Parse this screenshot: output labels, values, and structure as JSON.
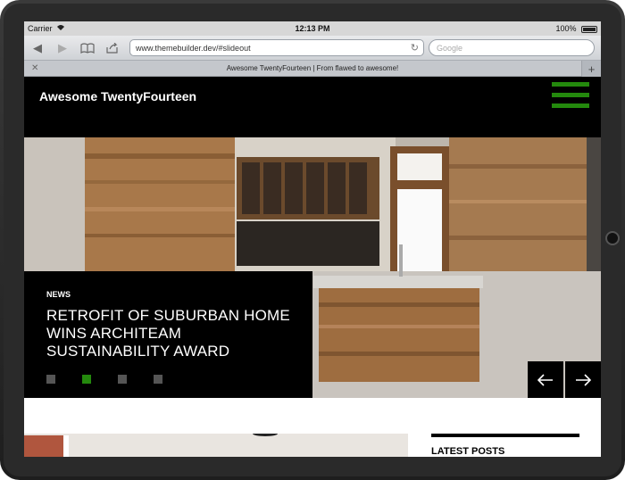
{
  "status_bar": {
    "carrier": "Carrier",
    "time": "12:13 PM",
    "battery": "100%"
  },
  "browser": {
    "url": "www.themebuilder.dev/#slideout",
    "search_placeholder": "Google",
    "tab_title": "Awesome TwentyFourteen | From flawed to awesome!"
  },
  "site": {
    "title": "Awesome TwentyFourteen"
  },
  "slider": {
    "category": "NEWS",
    "title": "RETROFIT OF SUBURBAN HOME WINS ARCHITEAM SUSTAINABILITY AWARD",
    "dots": 4,
    "active_dot": 2
  },
  "sidebar": {
    "widget_title": "LATEST POSTS"
  },
  "colors": {
    "accent": "#24890d",
    "header_bg": "#000000"
  }
}
